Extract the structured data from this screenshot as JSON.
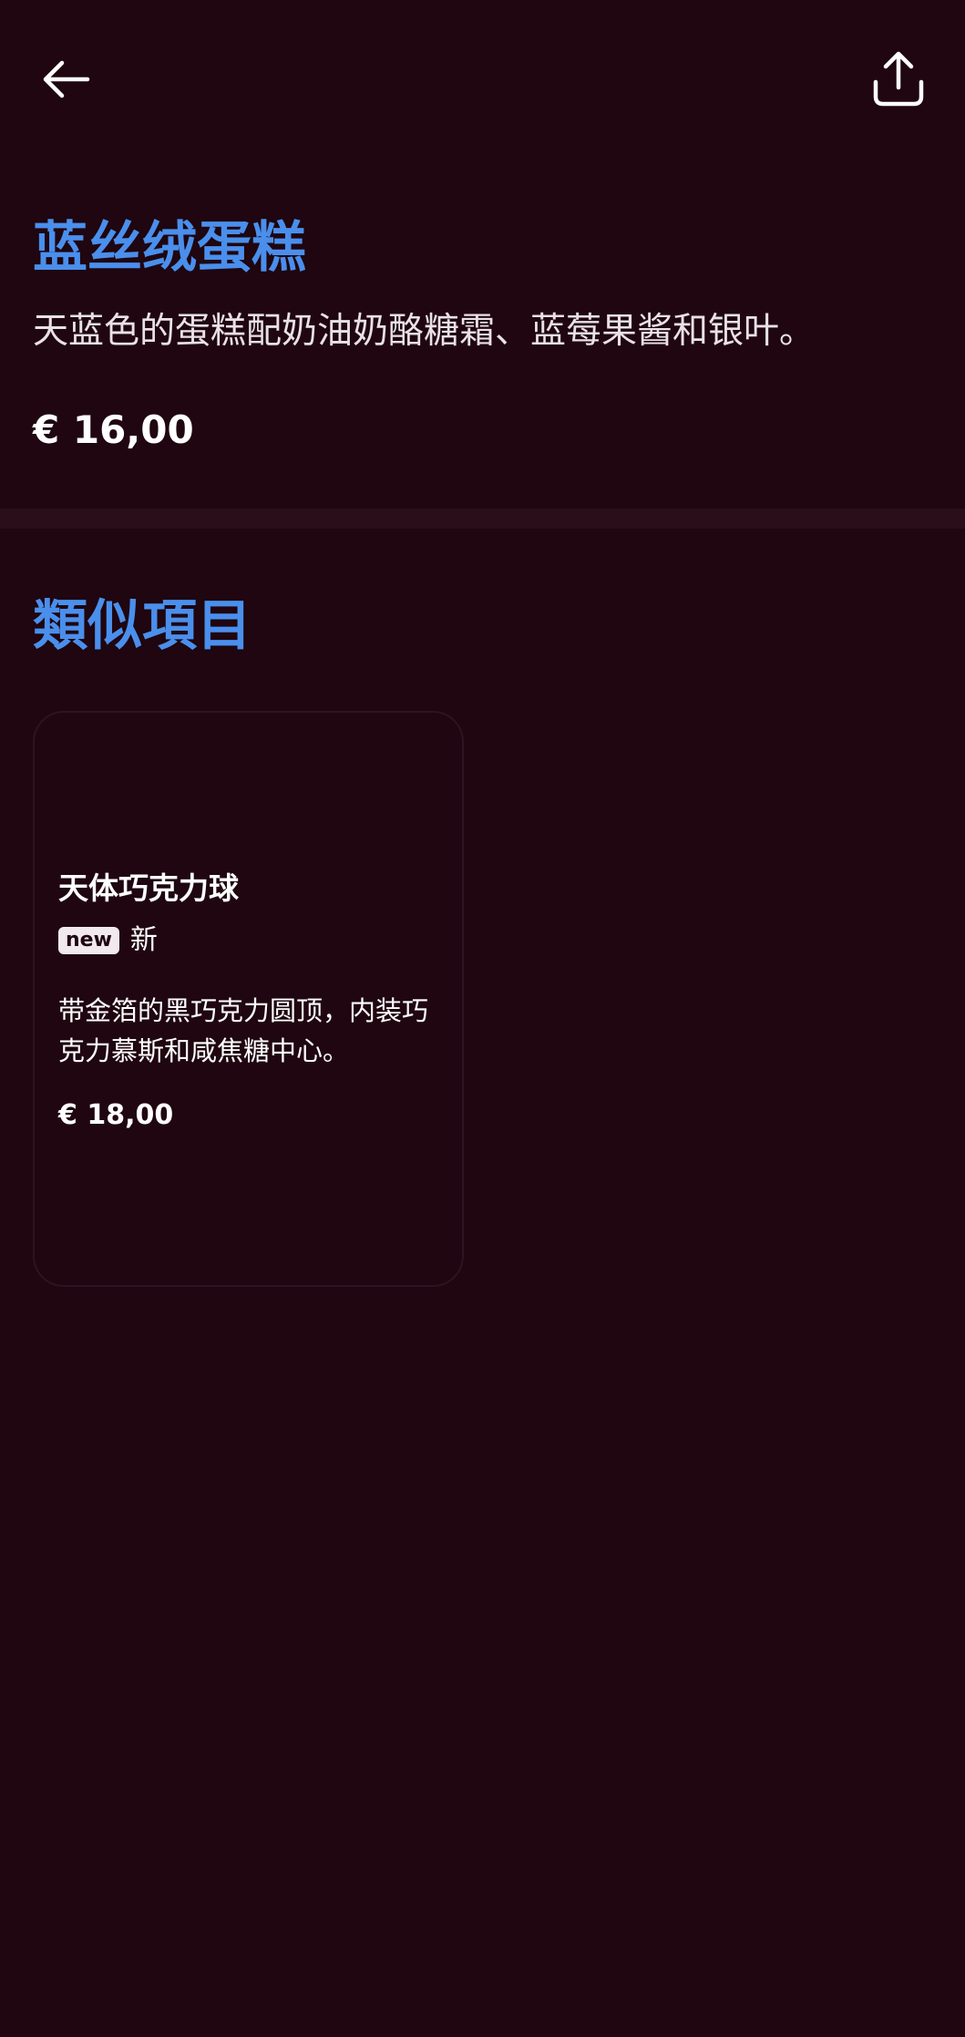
{
  "header": {
    "back_icon": "arrow-left-icon",
    "share_icon": "share-icon"
  },
  "product": {
    "title": "蓝丝绒蛋糕",
    "description": "天蓝色的蛋糕配奶油奶酪糖霜、蓝莓果酱和银叶。",
    "price": "€ 16,00"
  },
  "similar": {
    "heading": "類似項目",
    "items": [
      {
        "name": "天体巧克力球",
        "badge": "new",
        "badge_label": "新",
        "description": "带金箔的黑巧克力圆顶，内装巧克力慕斯和咸焦糖中心。",
        "price": "€ 18,00"
      }
    ]
  },
  "colors": {
    "background": "#1f0610",
    "accent": "#4a8fec",
    "divider": "#2a0f1a"
  }
}
